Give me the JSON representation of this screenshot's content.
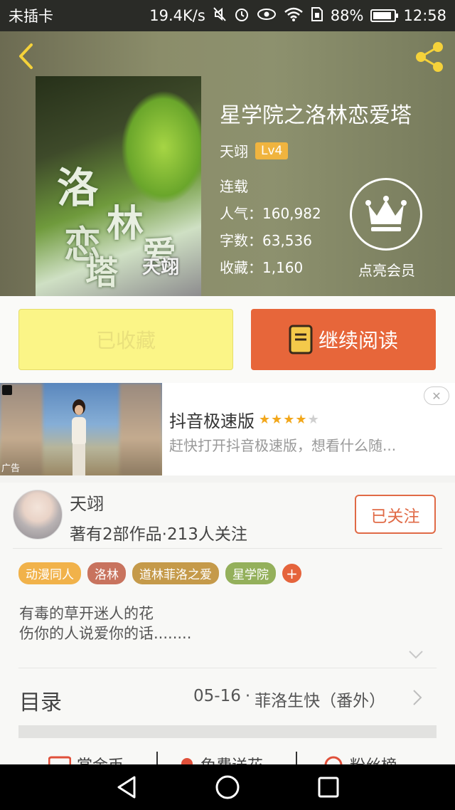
{
  "status_bar": {
    "carrier": "未插卡",
    "speed": "19.4K/s",
    "battery_pct": "88%",
    "battery_level": 0.88,
    "time": "12:58"
  },
  "header": {
    "book_title": "星学院之洛林恋爱塔",
    "author": "天翊",
    "level": "Lv4",
    "status": "连载",
    "popularity_label": "人气：",
    "popularity": "160,982",
    "words_label": "字数：",
    "words": "63,536",
    "favorites_label": "收藏：",
    "favorites": "1,160",
    "vip_label": "点亮会员",
    "cover_text": [
      "洛",
      "林",
      "恋",
      "爱",
      "塔",
      "天翊"
    ]
  },
  "actions": {
    "favorited_label": "已收藏",
    "continue_label": "继续阅读"
  },
  "ad": {
    "title": "抖音极速版",
    "rating": 4,
    "rating_max": 5,
    "description": "赶快打开抖音极速版，想看什么随...",
    "badge": "广告"
  },
  "author_card": {
    "name": "天翊",
    "stats": "著有2部作品·213人关注",
    "follow_label": "已关注"
  },
  "tags": [
    {
      "label": "动漫同人",
      "color": "#f1b24a"
    },
    {
      "label": "洛林",
      "color": "#c8735e"
    },
    {
      "label": "道林菲洛之爱",
      "color": "#c59a4a"
    },
    {
      "label": "星学院",
      "color": "#94b05b"
    }
  ],
  "intro": {
    "line1": "有毒的草开迷人的花",
    "line2": "伤你的人说爱你的话........"
  },
  "toc": {
    "label": "目录",
    "latest_date": "05-16",
    "latest_sep": "·",
    "latest_title": "菲洛生快（番外）"
  },
  "bottom_actions": [
    {
      "label": "赏金币",
      "icon": "coin-icon"
    },
    {
      "label": "免费送花",
      "icon": "flower-icon"
    },
    {
      "label": "粉丝榜",
      "icon": "ranking-icon"
    }
  ],
  "colors": {
    "accent": "#e7663a",
    "favorited_bg": "#fbf587",
    "level_badge": "#f0b43f"
  }
}
